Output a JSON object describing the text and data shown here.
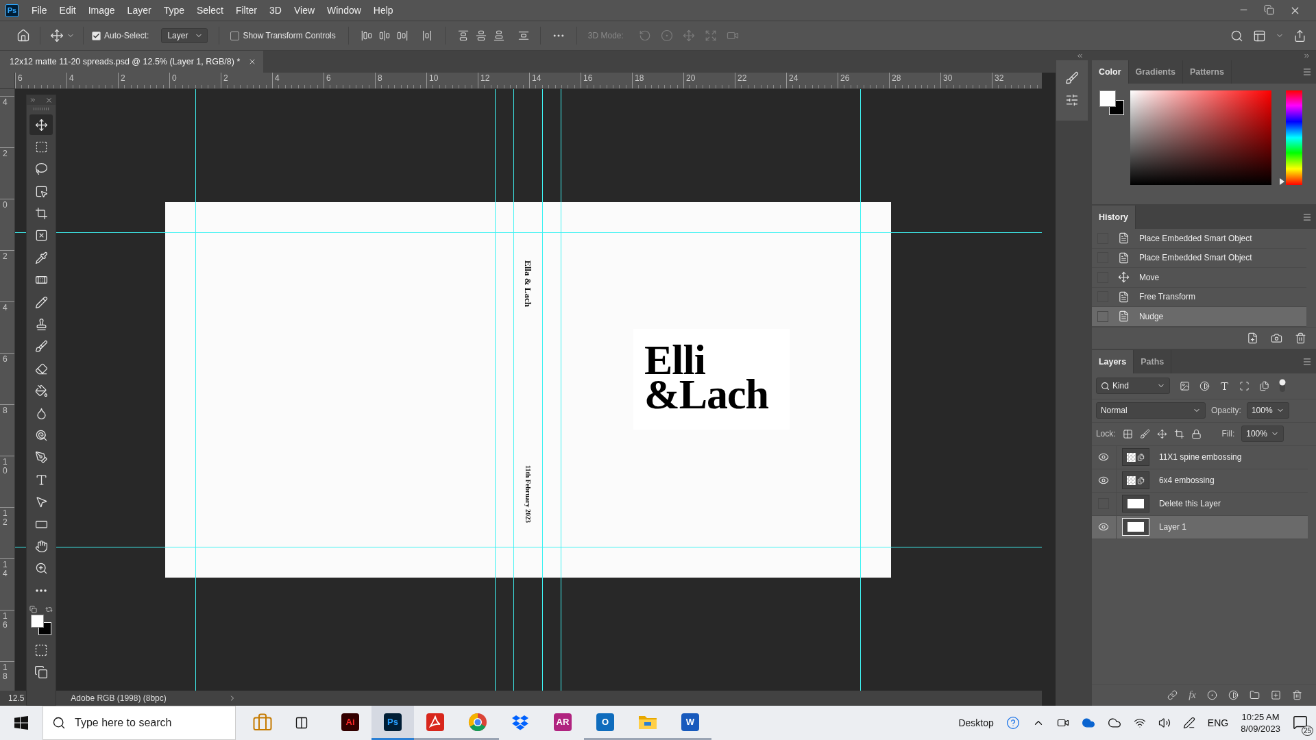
{
  "menu_bar": {
    "app_logo": "Ps",
    "items": [
      "File",
      "Edit",
      "Image",
      "Layer",
      "Type",
      "Select",
      "Filter",
      "3D",
      "View",
      "Window",
      "Help"
    ]
  },
  "options_bar": {
    "auto_select": {
      "label": "Auto-Select:",
      "checked": true
    },
    "target": "Layer",
    "transform_controls": {
      "label": "Show Transform Controls",
      "checked": false
    },
    "mode_3d": {
      "label": "3D Mode:",
      "disabled": true
    }
  },
  "document_tab": {
    "title": "12x12 matte 11-20 spreads.psd @ 12.5% (Layer 1, RGB/8) *"
  },
  "rulers": {
    "horizontal": [
      "6",
      "4",
      "2",
      "0",
      "2",
      "4",
      "6",
      "8",
      "10",
      "12",
      "14",
      "16",
      "18",
      "20",
      "22",
      "24",
      "26",
      "28",
      "30",
      "32"
    ],
    "vertical": [
      "4",
      "2",
      "0",
      "2",
      "4",
      "6",
      "8",
      "10",
      "12",
      "14",
      "16",
      "18"
    ]
  },
  "tools": [
    {
      "selected": true
    },
    {
      "selected": false
    },
    {
      "selected": false
    },
    {
      "selected": false
    },
    {
      "selected": false
    },
    {
      "selected": false
    },
    {
      "selected": false
    },
    {
      "selected": false
    },
    {
      "selected": false
    },
    {
      "selected": false
    },
    {
      "selected": false
    },
    {
      "selected": false
    },
    {
      "selected": false
    },
    {
      "selected": false
    },
    {
      "selected": false
    },
    {
      "selected": false
    },
    {
      "selected": false
    },
    {
      "selected": false
    },
    {
      "selected": false
    },
    {
      "selected": false
    },
    {
      "selected": false
    },
    {
      "selected": false
    }
  ],
  "document": {
    "spine_title": "Ella & Lach",
    "spine_date": "11th February 2023",
    "cover_title": [
      "Elli",
      "&Lach"
    ]
  },
  "status_bar": {
    "zoom": "12.5",
    "profile": "Adobe RGB (1998) (8bpc)"
  },
  "color_panel": {
    "tabs": [
      {
        "label": "Color",
        "selected": true
      },
      {
        "label": "Gradients",
        "selected": false
      },
      {
        "label": "Patterns",
        "selected": false
      }
    ],
    "hue_slider": {
      "level": 0
    }
  },
  "history_panel": {
    "tabs": [
      {
        "label": "History",
        "selected": true
      }
    ],
    "states": [
      {
        "label": "Place Embedded Smart Object",
        "kind": "document",
        "selected": false
      },
      {
        "label": "Place Embedded Smart Object",
        "kind": "document",
        "selected": false
      },
      {
        "label": "Move",
        "kind": "move",
        "selected": false
      },
      {
        "label": "Free Transform",
        "kind": "document",
        "selected": false
      },
      {
        "label": "Nudge",
        "kind": "document",
        "selected": true
      }
    ]
  },
  "layers_panel": {
    "tabs": [
      {
        "label": "Layers",
        "selected": true
      },
      {
        "label": "Paths",
        "selected": false
      }
    ],
    "filter": "Kind",
    "blend_mode": "Normal",
    "opacity_label": "Opacity:",
    "opacity": "100%",
    "lock_label": "Lock:",
    "fill_label": "Fill:",
    "fill": "100%",
    "fx_label": "fx",
    "layers": [
      {
        "name": "11X1 spine embossing",
        "kind": "smart",
        "visible": true,
        "selected": false
      },
      {
        "name": "6x4 embossing",
        "kind": "smart",
        "visible": true,
        "selected": false
      },
      {
        "name": "Delete this Layer",
        "kind": "raster",
        "visible": false,
        "selected": false
      },
      {
        "name": "Layer 1",
        "kind": "raster",
        "visible": true,
        "selected": true
      }
    ]
  },
  "taskbar": {
    "search_placeholder": "Type here to search",
    "apps": [
      {
        "kind": "tile",
        "glyph": "Ai",
        "color": "#330000",
        "selected": false,
        "running": false
      },
      {
        "kind": "tile",
        "glyph": "Ps",
        "color": "#001e36",
        "selected": true,
        "running": true
      },
      {
        "kind": "acrobat",
        "selected": false,
        "running": true
      },
      {
        "kind": "chrome",
        "selected": false,
        "running": true
      },
      {
        "kind": "dropbox",
        "selected": false,
        "running": false
      },
      {
        "kind": "tile",
        "glyph": "AR",
        "color": "#b0237f",
        "selected": false,
        "running": false
      },
      {
        "kind": "tile",
        "glyph": "O",
        "color": "#0f6cbd",
        "selected": false,
        "running": true
      },
      {
        "kind": "folder",
        "selected": false,
        "running": true
      },
      {
        "kind": "tile",
        "glyph": "W",
        "color": "#185abd",
        "selected": false,
        "running": true
      }
    ],
    "desktop_label": "Desktop",
    "language": "ENG",
    "time": "10:25 AM",
    "date": "8/09/2023",
    "notifications": "25"
  }
}
